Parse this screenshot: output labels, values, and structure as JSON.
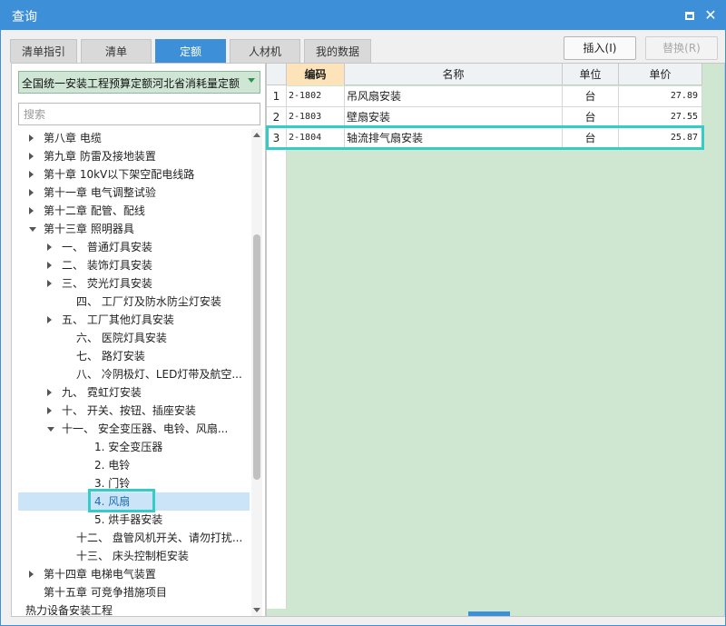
{
  "window": {
    "title": "查询"
  },
  "tabs": [
    "清单指引",
    "清单",
    "定额",
    "人材机",
    "我的数据"
  ],
  "active_tab": "定额",
  "buttons": {
    "insert": "插入(I)",
    "replace": "替换(R)"
  },
  "selector": {
    "value": "全国统一安装工程预算定额河北省消耗量定额("
  },
  "search": {
    "placeholder": "搜索"
  },
  "tree": [
    {
      "label": "第八章 电缆",
      "arrow": "right"
    },
    {
      "label": "第九章 防雷及接地装置",
      "arrow": "right"
    },
    {
      "label": "第十章 10kV以下架空配电线路",
      "arrow": "right"
    },
    {
      "label": "第十一章 电气调整试验",
      "arrow": "right"
    },
    {
      "label": "第十二章 配管、配线",
      "arrow": "right"
    },
    {
      "label": "第十三章 照明器具",
      "arrow": "down"
    },
    {
      "label": "一、 普通灯具安装",
      "arrow": "right"
    },
    {
      "label": "二、 装饰灯具安装",
      "arrow": "right"
    },
    {
      "label": "三、 荧光灯具安装",
      "arrow": "right"
    },
    {
      "label": "四、 工厂灯及防水防尘灯安装",
      "arrow": ""
    },
    {
      "label": "五、 工厂其他灯具安装",
      "arrow": "right"
    },
    {
      "label": "六、 医院灯具安装",
      "arrow": ""
    },
    {
      "label": "七、 路灯安装",
      "arrow": ""
    },
    {
      "label": "八、 冷阴极灯、LED灯带及航空...",
      "arrow": ""
    },
    {
      "label": "九、 霓虹灯安装",
      "arrow": "right"
    },
    {
      "label": "十、 开关、按钮、插座安装",
      "arrow": "right"
    },
    {
      "label": "十一、 安全变压器、电铃、风扇...",
      "arrow": "down"
    },
    {
      "label": "1. 安全变压器",
      "arrow": ""
    },
    {
      "label": "2. 电铃",
      "arrow": ""
    },
    {
      "label": "3. 门铃",
      "arrow": ""
    },
    {
      "label": "4. 风扇",
      "arrow": "",
      "selected": true
    },
    {
      "label": "5. 烘手器安装",
      "arrow": ""
    },
    {
      "label": "十二、 盘管风机开关、请勿打扰...",
      "arrow": ""
    },
    {
      "label": "十三、 床头控制柜安装",
      "arrow": ""
    },
    {
      "label": "第十四章 电梯电气装置",
      "arrow": "right"
    },
    {
      "label": "第十五章 可竞争措施项目",
      "arrow": ""
    },
    {
      "label": "热力设备安装工程",
      "arrow": "right"
    }
  ],
  "grid": {
    "headers": [
      "编码",
      "名称",
      "单位",
      "单价"
    ],
    "rows": [
      {
        "num": "1",
        "code": "2-1802",
        "name": "吊风扇安装",
        "unit": "台",
        "price": "27.89"
      },
      {
        "num": "2",
        "code": "2-1803",
        "name": "壁扇安装",
        "unit": "台",
        "price": "27.55"
      },
      {
        "num": "3",
        "code": "2-1804",
        "name": "轴流排气扇安装",
        "unit": "台",
        "price": "25.87"
      }
    ]
  }
}
